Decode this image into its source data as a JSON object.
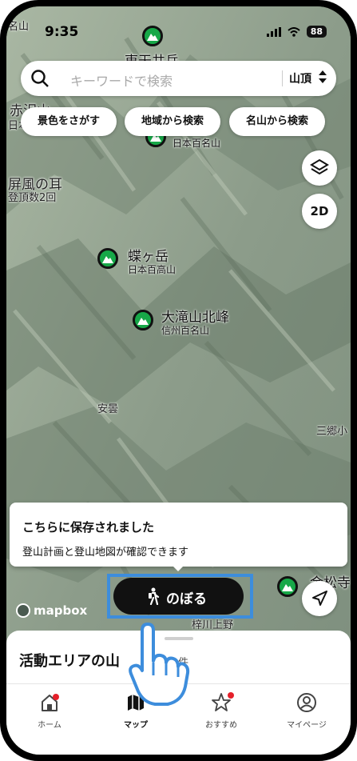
{
  "status": {
    "time": "9:35",
    "battery": "88"
  },
  "search": {
    "placeholder": "キーワードで検索",
    "filter_label": "山頂"
  },
  "chips": [
    "景色をさがす",
    "地域から検索",
    "名山から検索"
  ],
  "controls": {
    "two_d_label": "2D"
  },
  "map": {
    "peaks": [
      {
        "name": "東天井岳",
        "sub": ""
      },
      {
        "name": "",
        "sub": "日本百名山"
      },
      {
        "name": "蝶ヶ岳",
        "sub": "日本百高山"
      },
      {
        "name": "大滝山北峰",
        "sub": "信州百名山"
      },
      {
        "name": "金松寺",
        "sub": ""
      }
    ],
    "labels": {
      "top_left": "名山",
      "akazawa": "赤沢山",
      "akazawa_sub": "日本百",
      "byobu": "屏風の耳",
      "byobu_sub": "登頂数2回",
      "azumi": "安曇",
      "sango": "三郷小",
      "azusa": "梓川上野"
    },
    "attribution": "mapbox"
  },
  "tooltip": {
    "title": "こちらに保存されました",
    "body": "登山計画と登山地図が確認できます"
  },
  "climb_button": {
    "label": "のぼる"
  },
  "sheet": {
    "title": "活動エリアの山",
    "count_suffix": "件"
  },
  "tabs": [
    {
      "label": "ホーム",
      "icon": "home-icon",
      "badge": true
    },
    {
      "label": "マップ",
      "icon": "map-icon",
      "badge": false,
      "active": true
    },
    {
      "label": "おすすめ",
      "icon": "star-icon",
      "badge": true
    },
    {
      "label": "マイページ",
      "icon": "user-icon",
      "badge": false
    }
  ],
  "colors": {
    "pin_green": "#17a848",
    "highlight_blue": "#3d8ddc",
    "badge_red": "#e5202a",
    "button_black": "#111111"
  }
}
